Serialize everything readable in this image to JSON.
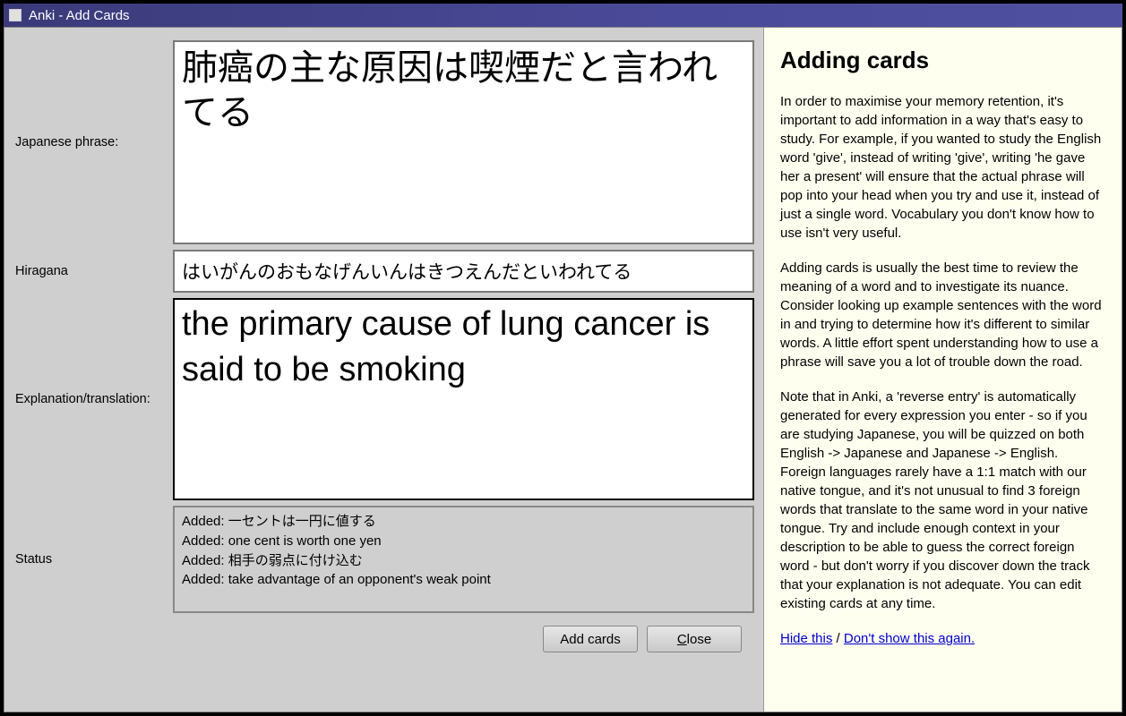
{
  "window": {
    "title": "Anki - Add Cards"
  },
  "form": {
    "japanese_label": "Japanese phrase:",
    "japanese_value": "肺癌の主な原因は喫煙だと言われてる",
    "hiragana_label": "Hiragana",
    "hiragana_value": "はいがんのおもなげんいんはきつえんだといわれてる",
    "explanation_label": "Explanation/translation:",
    "explanation_value": "the primary cause of lung cancer is said to be smoking",
    "status_label": "Status",
    "status_lines": [
      "Added: 一セントは一円に値する",
      "Added: one cent is worth one yen",
      "Added: 相手の弱点に付け込む",
      "Added: take advantage of an opponent's weak point"
    ]
  },
  "buttons": {
    "add": "Add cards",
    "close_prefix": "",
    "close_ul": "C",
    "close_rest": "lose"
  },
  "help": {
    "heading": "Adding cards",
    "p1": "In order to maximise your memory retention, it's important to add information in a way that's easy to study. For example, if you wanted to study the English word 'give', instead of writing 'give', writing 'he gave her a present' will ensure that the actual phrase will pop into your head when you try and use it, instead of just a single word. Vocabulary you don't know how to use isn't very useful.",
    "p2": "Adding cards is usually the best time to review the meaning of a word and to investigate its nuance. Consider looking up example sentences with the word in and trying to determine how it's different to similar words. A little effort spent understanding how to use a phrase will save you a lot of trouble down the road.",
    "p3": "Note that in Anki, a 'reverse entry' is automatically generated for every expression you enter - so if you are studying Japanese, you will be quizzed on both English -> Japanese and Japanese -> English. Foreign languages rarely have a 1:1 match with our native tongue, and it's not unusual to find 3 foreign words that translate to the same word in your native tongue. Try and include enough context in your description to be able to guess the correct foreign word - but don't worry if you discover down the track that your explanation is not adequate. You can edit existing cards at any time.",
    "hide": "Hide this",
    "sep": " / ",
    "dont": "Don't show this again."
  }
}
